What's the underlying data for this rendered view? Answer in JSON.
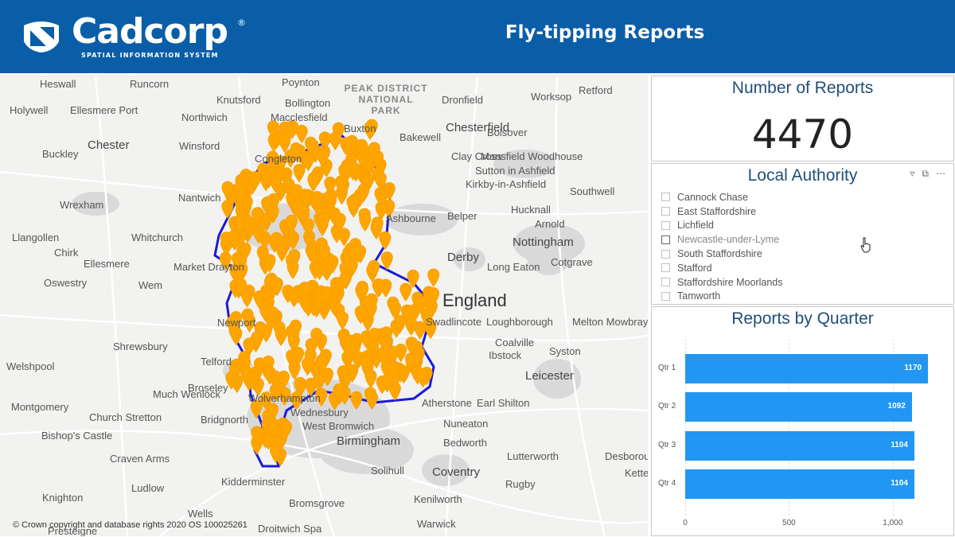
{
  "header": {
    "logo_word": "Cadcorp",
    "logo_reg": "®",
    "logo_sub": "SPATIAL INFORMATION SYSTEM",
    "title": "Fly-tipping Reports"
  },
  "map": {
    "copyright": "© Crown copyright and database rights 2020 OS 100025261",
    "places": [
      "Heswall",
      "Runcorn",
      "Poynton",
      "Knutsford",
      "Bollington",
      "PEAK DISTRICT NATIONAL PARK",
      "Dronfield",
      "Worksop",
      "Retford",
      "Holywell",
      "Ellesmere Port",
      "Northwich",
      "Macclesfield",
      "Buxton",
      "Chesterfield",
      "Bolsover",
      "Chester",
      "Winsford",
      "Bakewell",
      "Buckley",
      "Congleton",
      "Clay Cross",
      "Mansfield Woodhouse",
      "Sutton in Ashfield",
      "Kirkby-in-Ashfield",
      "Southwell",
      "Nantwich",
      "Wrexham",
      "Ashbourne",
      "Belper",
      "Hucknall",
      "Arnold",
      "Llangollen",
      "Whitchurch",
      "Nottingham",
      "Chirk",
      "Ellesmere",
      "Derby",
      "Long Eaton",
      "Cotgrave",
      "Market Drayton",
      "Oswestry",
      "Wem",
      "England",
      "Newport",
      "Swadlincote",
      "Loughborough",
      "Melton Mowbray",
      "Shrewsbury",
      "Coalville",
      "Ibstock",
      "Syston",
      "Welshpool",
      "Telford",
      "Leicester",
      "Much Wenlock",
      "Broseley",
      "Montgomery",
      "Church Stretton",
      "Bridgnorth",
      "Wolverhampton",
      "Wednesbury",
      "West Bromwich",
      "Atherstone",
      "Earl Shilton",
      "Bishop's Castle",
      "Birmingham",
      "Nuneaton",
      "Bedworth",
      "Craven Arms",
      "Solihull",
      "Coventry",
      "Lutterworth",
      "Ludlow",
      "Kidderminster",
      "Rugby",
      "Knighton",
      "Wells",
      "Bromsgrove",
      "Kenilworth",
      "Droitwich Spa",
      "Warwick",
      "Presteigne",
      "Desborough",
      "Kettering"
    ]
  },
  "kpi": {
    "title": "Number of Reports",
    "value": "4470"
  },
  "local_authority": {
    "title": "Local Authority",
    "items": [
      "Cannock Chase",
      "East Staffordshire",
      "Lichfield",
      "Newcastle-under-Lyme",
      "South Staffordshire",
      "Stafford",
      "Staffordshire Moorlands",
      "Tamworth"
    ]
  },
  "chart_data": {
    "type": "bar",
    "title": "Reports by Quarter",
    "categories": [
      "Qtr 1",
      "Qtr 2",
      "Qtr 3",
      "Qtr 4"
    ],
    "values": [
      1170,
      1092,
      1104,
      1104
    ],
    "xticks": [
      "0",
      "500",
      "1,000"
    ],
    "xlim": [
      0,
      1250
    ],
    "orientation": "horizontal",
    "color": "#2196f3"
  }
}
